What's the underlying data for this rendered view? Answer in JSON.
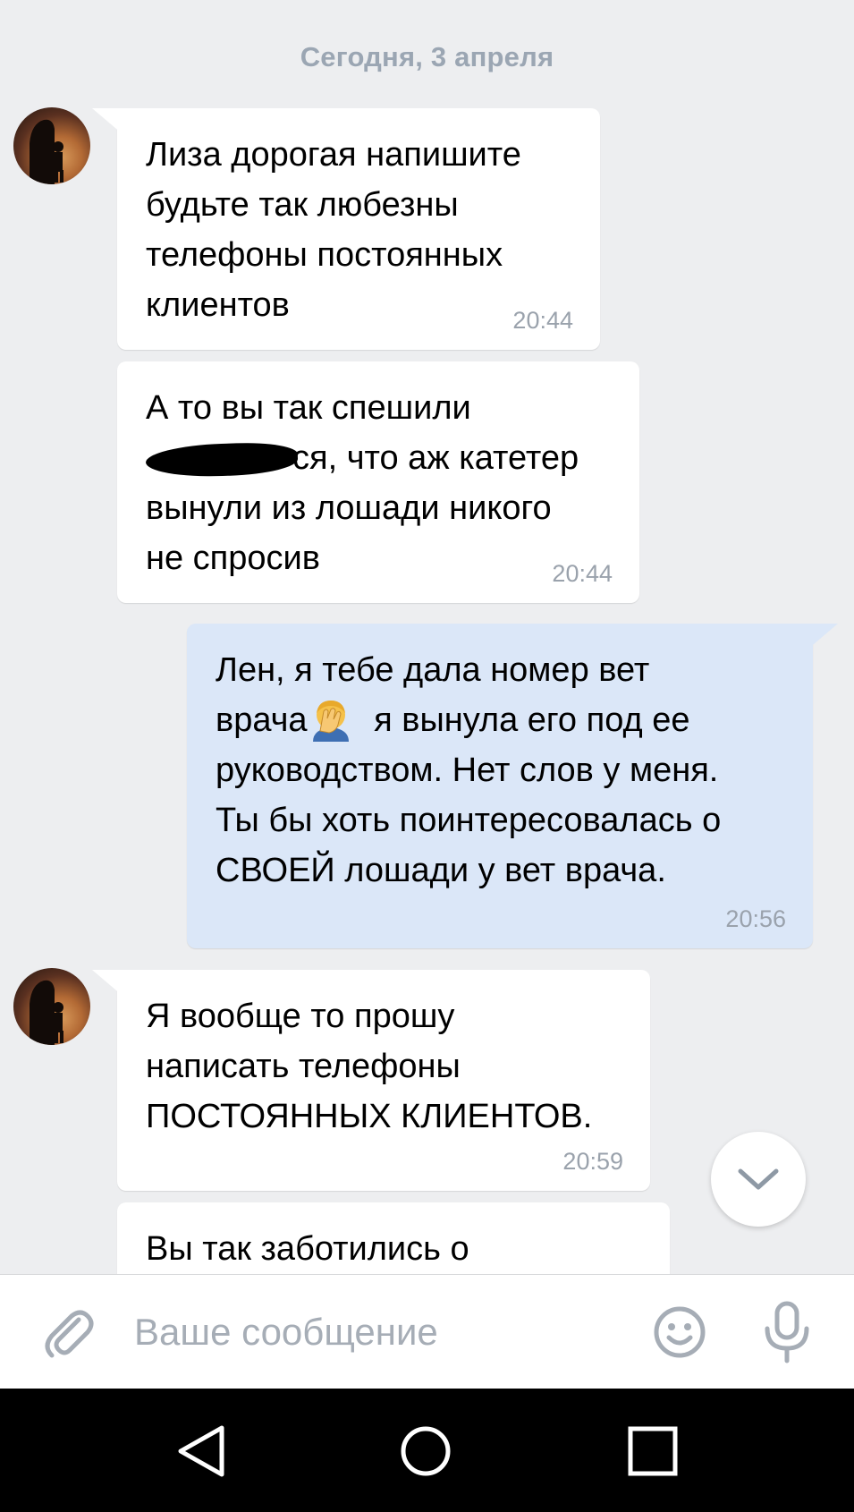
{
  "chat": {
    "date_separator": "Сегодня, 3 апреля",
    "messages": [
      {
        "direction": "incoming",
        "lines": [
          "Лиза дорогая напишите",
          "будьте так любезны",
          "телефоны постоянных",
          "клиентов"
        ],
        "time": "20:44"
      },
      {
        "direction": "incoming",
        "lines": [
          "А то вы так спешили",
          "ся, что аж катетер",
          "вынули из лошади никого",
          "не спросив"
        ],
        "redacted_prefix_on_line": 1,
        "time": "20:44"
      },
      {
        "direction": "outgoing",
        "lines": [
          "Лен, я тебе дала номер вет",
          "врача",
          " я вынула его под ее",
          "руководством. Нет слов у меня.",
          "Ты бы хоть поинтересовалась о",
          "СВОЕЙ лошади у вет врача."
        ],
        "emoji": "facepalm",
        "time": "20:56"
      },
      {
        "direction": "incoming",
        "lines": [
          "Я вообще то прошу",
          "написать телефоны",
          "ПОСТОЯННЫХ КЛИЕНТОВ."
        ],
        "time": "20:59"
      },
      {
        "direction": "incoming",
        "lines": [
          "Вы так заботились о"
        ],
        "time": ""
      }
    ],
    "scroll_down_icon": "chevron-down-icon"
  },
  "composer": {
    "placeholder": "Ваше сообщение",
    "attach_icon": "paperclip-icon",
    "emoji_icon": "smile-icon",
    "mic_icon": "microphone-icon"
  },
  "navbar": {
    "back_icon": "triangle-back-icon",
    "home_icon": "circle-home-icon",
    "recents_icon": "square-recents-icon"
  },
  "colors": {
    "chat_background": "#edeef0",
    "incoming_bubble": "#ffffff",
    "outgoing_bubble": "#dbe7f8",
    "timestamp": "#9aa2ac",
    "date_separator": "#9ba6b3",
    "icon_gray": "#a6adb6",
    "navbar": "#000000"
  }
}
